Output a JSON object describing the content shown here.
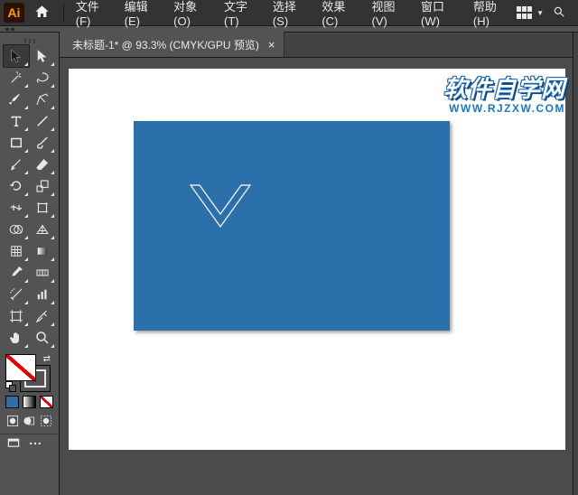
{
  "app": {
    "logo_text": "Ai"
  },
  "menu": {
    "items": [
      {
        "label": "文件(F)"
      },
      {
        "label": "编辑(E)"
      },
      {
        "label": "对象(O)"
      },
      {
        "label": "文字(T)"
      },
      {
        "label": "选择(S)"
      },
      {
        "label": "效果(C)"
      },
      {
        "label": "视图(V)"
      },
      {
        "label": "窗口(W)"
      },
      {
        "label": "帮助(H)"
      }
    ]
  },
  "document": {
    "tab_title": "未标题-1* @ 93.3% (CMYK/GPU 预览)",
    "close_glyph": "×"
  },
  "artboard": {
    "fill_color": "#2b6fab"
  },
  "watermark": {
    "cn": "软件自学网",
    "en": "WWW.RJZXW.COM"
  },
  "tools": {
    "names": [
      [
        "selection",
        "direct-selection"
      ],
      [
        "magic-wand",
        "lasso"
      ],
      [
        "pen",
        "curvature"
      ],
      [
        "type",
        "line-segment"
      ],
      [
        "rectangle",
        "paintbrush"
      ],
      [
        "shaper",
        "eraser"
      ],
      [
        "rotate",
        "scale"
      ],
      [
        "width",
        "free-transform"
      ],
      [
        "shape-builder",
        "perspective-grid"
      ],
      [
        "mesh",
        "gradient"
      ],
      [
        "eyedropper",
        "blend"
      ],
      [
        "symbol-sprayer",
        "column-graph"
      ],
      [
        "artboard",
        "slice"
      ],
      [
        "hand",
        "zoom"
      ]
    ]
  }
}
